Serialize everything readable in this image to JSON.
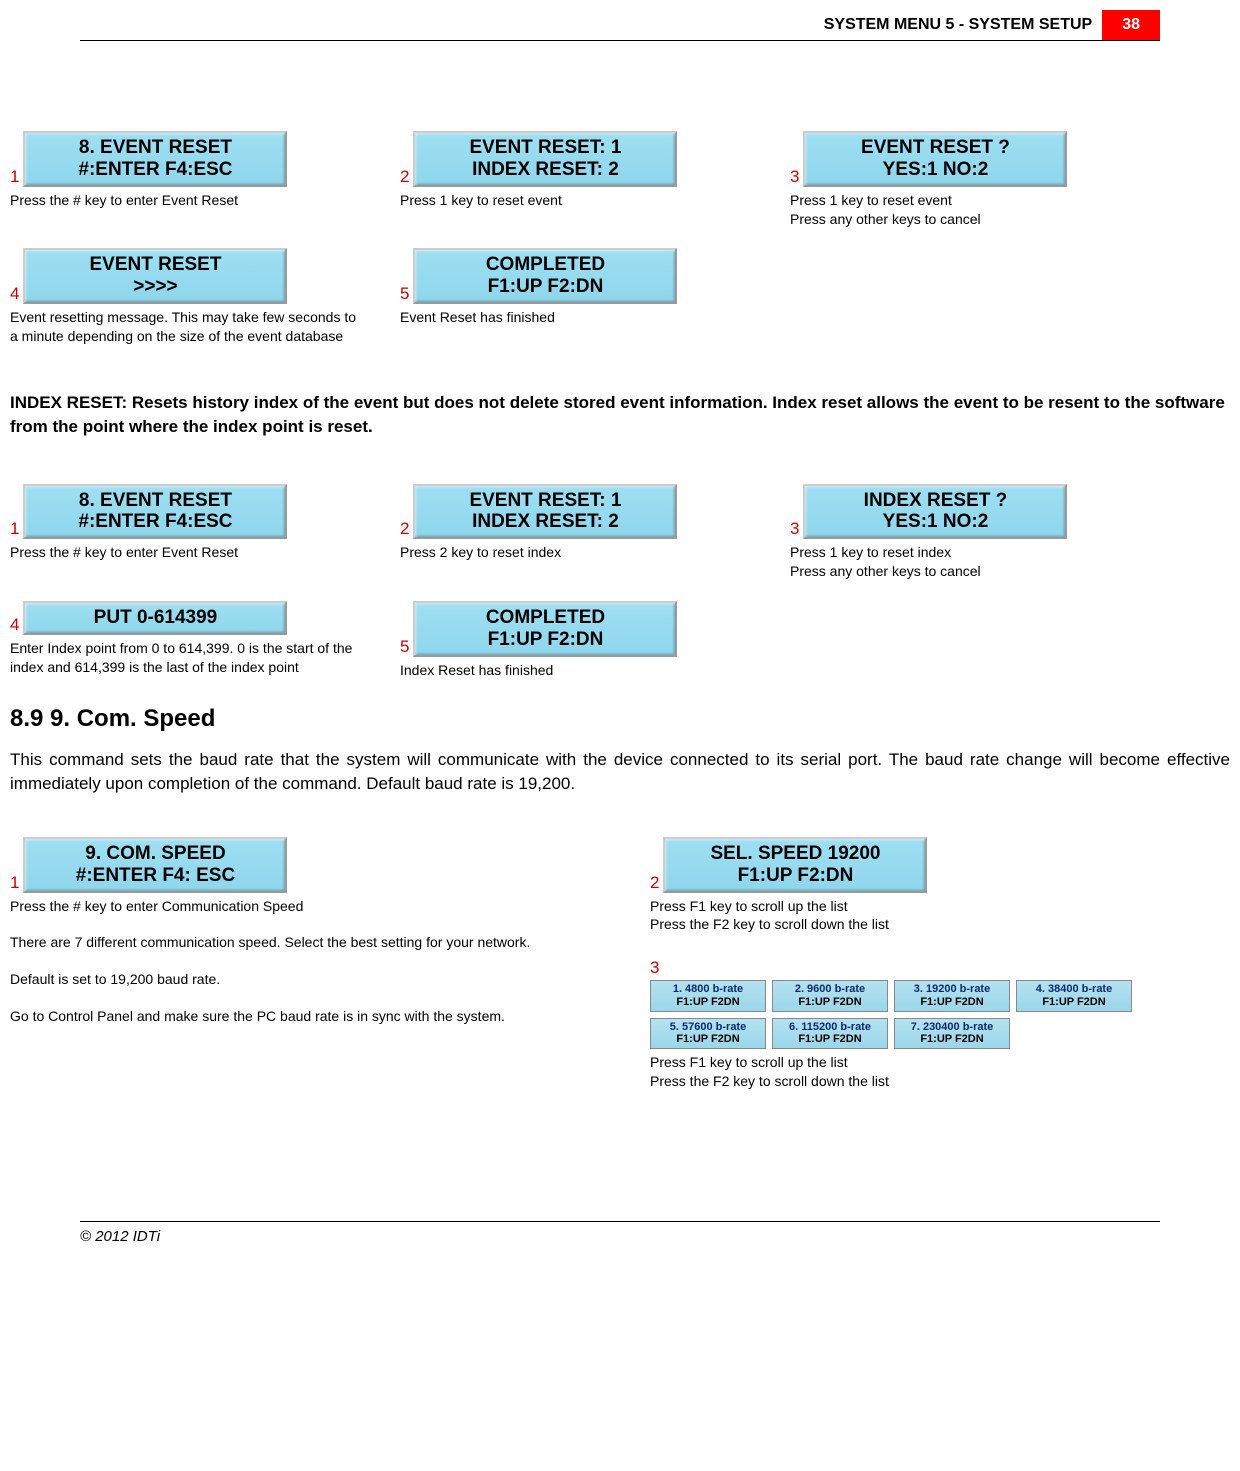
{
  "header": {
    "title": "SYSTEM MENU 5 - SYSTEM SETUP",
    "page": "38"
  },
  "event_reset_steps": [
    {
      "num": "1",
      "lcd": [
        "8. EVENT RESET",
        "#:ENTER   F4:ESC"
      ],
      "cap": "Press the # key to enter Event Reset"
    },
    {
      "num": "2",
      "lcd": [
        "EVENT RESET:   1",
        "INDEX RESET:    2"
      ],
      "cap": "Press 1 key to reset event"
    },
    {
      "num": "3",
      "lcd": [
        "EVENT RESET  ?",
        "YES:1      NO:2"
      ],
      "cap": "Press 1 key to reset event\nPress any other keys to cancel"
    },
    {
      "num": "4",
      "lcd": [
        "EVENT RESET",
        ">>>>"
      ],
      "cap": "Event resetting message. This may take few seconds to a minute depending on the size of the event database"
    },
    {
      "num": "5",
      "lcd": [
        "COMPLETED",
        "F1:UP     F2:DN"
      ],
      "cap": "Event Reset has finished"
    }
  ],
  "index_reset_para": "INDEX RESET: Resets history index of the event but does not delete stored event information. Index reset allows the event to be resent to the software from the point where the index point is reset.",
  "index_reset_steps": [
    {
      "num": "1",
      "lcd": [
        "8. EVENT RESET",
        "#:ENTER   F4:ESC"
      ],
      "cap": "Press the # key to enter Event Reset"
    },
    {
      "num": "2",
      "lcd": [
        "EVENT RESET:   1",
        "INDEX RESET:    2"
      ],
      "cap": "Press 2 key to reset index"
    },
    {
      "num": "3",
      "lcd": [
        "INDEX RESET  ?",
        "YES:1      NO:2"
      ],
      "cap": "Press 1 key to reset index\nPress any other keys to cancel"
    },
    {
      "num": "4",
      "lcd": [
        "PUT 0-614399",
        ""
      ],
      "cap": "Enter Index point from 0 to 614,399. 0 is the start of the index and 614,399 is the last of the index point"
    },
    {
      "num": "5",
      "lcd": [
        "COMPLETED",
        "F1:UP     F2:DN"
      ],
      "cap": "Index Reset has finished"
    }
  ],
  "com_speed": {
    "heading": "8.9     9. Com. Speed",
    "para": "This command sets the baud rate that the system will communicate with the device connected to its serial port. The baud rate change will become effective immediately upon completion of the command. Default baud rate is 19,200.",
    "step1": {
      "num": "1",
      "lcd": [
        "9. COM.   SPEED",
        "#:ENTER  F4: ESC"
      ],
      "cap": "Press the # key to enter Communication Speed"
    },
    "step2": {
      "num": "2",
      "lcd": [
        "SEL. SPEED 19200",
        "F1:UP   F2:DN"
      ],
      "cap": "Press F1 key to scroll up the list\nPress the F2 key to scroll down the list"
    },
    "step3_num": "3",
    "left_notes": [
      "There are 7 different communication speed. Select the best setting for your network.",
      "Default is set to 19,200 baud rate.",
      "Go to Control Panel and make sure the PC baud rate is in sync with the system."
    ],
    "speed_chips": [
      "1. 4800 b-rate",
      "2. 9600 b-rate",
      "3. 19200 b-rate",
      "4. 38400 b-rate",
      "5. 57600 b-rate",
      "6. 115200 b-rate",
      "7. 230400 b-rate"
    ],
    "chip_sub": "F1:UP   F2DN",
    "step3_cap": "Press F1 key to scroll up the list\nPress the F2 key to scroll down the list"
  },
  "footer": "© 2012 IDTi"
}
